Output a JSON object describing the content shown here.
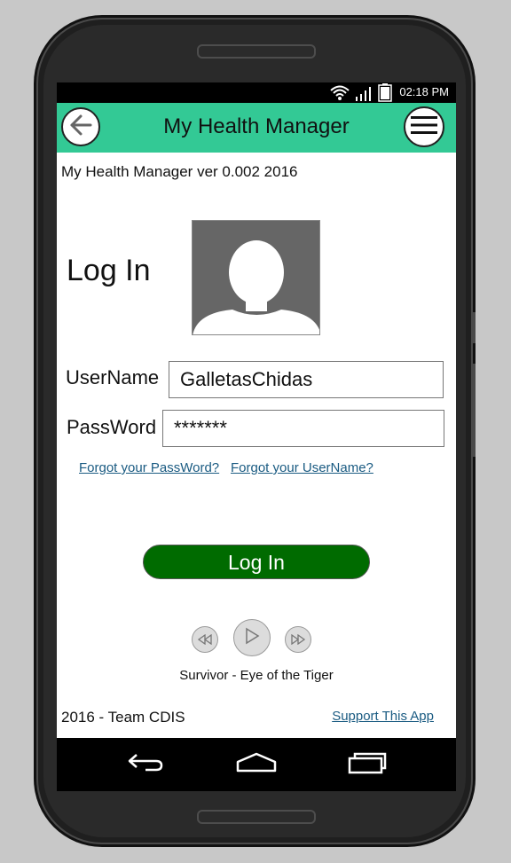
{
  "status": {
    "time": "02:18 PM"
  },
  "appbar": {
    "title": "My Health Manager"
  },
  "version_text": "My Health Manager ver 0.002 2016",
  "login": {
    "heading": "Log In",
    "username_label": "UserName",
    "username_value": "GalletasChidas",
    "password_label": "PassWord",
    "password_value": "*******",
    "forgot_password": "Forgot your PassWord?",
    "forgot_username": "Forgot your UserName?",
    "button_label": "Log In"
  },
  "player": {
    "track": "Survivor - Eye of the Tiger"
  },
  "footer": {
    "left": "2016 - Team CDIS",
    "support_link": "Support This App"
  },
  "colors": {
    "appbar": "#33c995",
    "login_button": "#006b00",
    "link": "#1a5b82"
  },
  "icons": [
    "back-arrow-icon",
    "hamburger-menu-icon",
    "wifi-icon",
    "signal-icon",
    "battery-icon",
    "avatar-icon",
    "rewind-icon",
    "play-icon",
    "fast-forward-icon",
    "nav-back-icon",
    "nav-home-icon",
    "nav-recents-icon"
  ]
}
